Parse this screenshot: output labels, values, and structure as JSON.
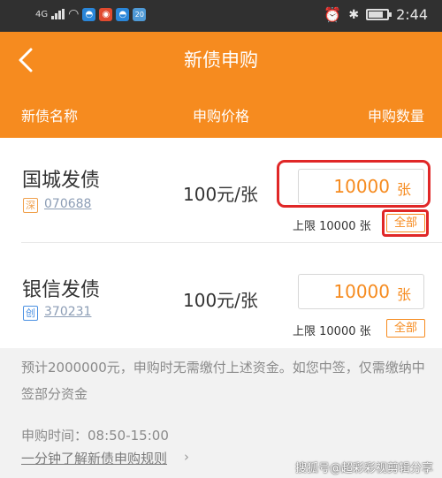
{
  "status_bar": {
    "network": "4G",
    "time": "2:44",
    "apps": [
      {
        "icon": "app-bird-icon",
        "color": "#2a86d9",
        "glyph": "◓"
      },
      {
        "icon": "app-red-icon",
        "color": "#e04a2f",
        "glyph": "◉"
      },
      {
        "icon": "app-bird2-icon",
        "color": "#2a86d9",
        "glyph": "◓"
      },
      {
        "icon": "app-badge-icon",
        "color": "#4f9ad6",
        "glyph": "20"
      }
    ]
  },
  "header": {
    "title": "新债申购",
    "col_name": "新债名称",
    "col_price": "申购价格",
    "col_qty": "申购数量"
  },
  "bonds": [
    {
      "name": "国城发债",
      "market": "深",
      "market_color": "#f0a04b",
      "code": "070688",
      "price": "100元/张",
      "qty": "10000",
      "unit": "张",
      "limit": "上限 10000 张",
      "all_label": "全部"
    },
    {
      "name": "银信发债",
      "market": "创",
      "market_color": "#4a90e2",
      "code": "370231",
      "price": "100元/张",
      "qty": "10000",
      "unit": "张",
      "limit": "上限 10000 张",
      "all_label": "全部"
    }
  ],
  "note": "预计2000000元，申购时无需缴付上述资金。如您中签，仅需缴纳中签部分资金",
  "time_text": "申购时间：08:50-15:00",
  "rules_link": "一分钟了解新债申购规则",
  "watermark": "搜狐号@超彩彩视剪辑分享",
  "colors": {
    "accent": "#f68b1f",
    "highlight": "#e02727"
  }
}
